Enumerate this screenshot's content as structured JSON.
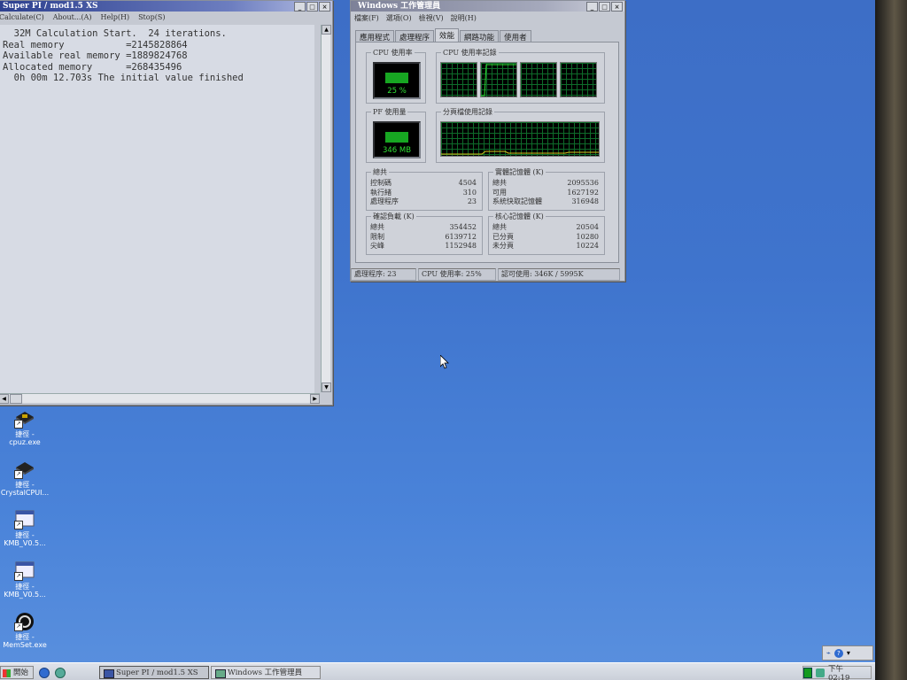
{
  "superpi": {
    "title": "Super PI / mod1.5 XS",
    "menu": [
      "Calculate(C)",
      "About...(A)",
      "Help(H)",
      "Stop(S)"
    ],
    "output_lines": [
      "  32M Calculation Start.  24 iterations.",
      "Real memory           =2145828864",
      "Available real memory =1889824768",
      "Allocated memory      =268435496",
      "  0h 00m 12.703s The initial value finished"
    ]
  },
  "taskmgr": {
    "title": "Windows 工作管理員",
    "menu": [
      "檔案(F)",
      "選項(O)",
      "檢視(V)",
      "說明(H)"
    ],
    "tabs": [
      "應用程式",
      "處理程序",
      "效能",
      "網路功能",
      "使用者"
    ],
    "active_tab": 2,
    "cpu_usage_label": "CPU 使用率",
    "cpu_usage_value": "25 %",
    "cpu_usage_fraction": 0.25,
    "cpu_history_label": "CPU 使用率記錄",
    "pf_usage_label": "PF 使用量",
    "pf_usage_value": "346 MB",
    "pf_history_label": "分頁檔使用記錄",
    "totals": {
      "label": "總共",
      "rows": [
        {
          "k": "控制碼",
          "v": "4504"
        },
        {
          "k": "執行緒",
          "v": "310"
        },
        {
          "k": "處理程序",
          "v": "23"
        }
      ]
    },
    "physical": {
      "label": "實體記憶體 (K)",
      "rows": [
        {
          "k": "總共",
          "v": "2095536"
        },
        {
          "k": "可用",
          "v": "1627192"
        },
        {
          "k": "系統快取記憶體",
          "v": "316948"
        }
      ]
    },
    "commit": {
      "label": "確認負載 (K)",
      "rows": [
        {
          "k": "總共",
          "v": "354452"
        },
        {
          "k": "限制",
          "v": "6139712"
        },
        {
          "k": "尖峰",
          "v": "1152948"
        }
      ]
    },
    "kernel": {
      "label": "核心記憶體 (K)",
      "rows": [
        {
          "k": "總共",
          "v": "20504"
        },
        {
          "k": "已分頁",
          "v": "10280"
        },
        {
          "k": "未分頁",
          "v": "10224"
        }
      ]
    },
    "status": {
      "processes": "處理程序: 23",
      "cpu": "CPU 使用率: 25%",
      "commit": "認可使用: 346K / 5995K"
    }
  },
  "desktop_icons": [
    {
      "line1": "捷徑 -",
      "line2": "cpuz.exe",
      "icon": "chip-icon"
    },
    {
      "line1": "捷徑 -",
      "line2": "CrystalCPUI...",
      "icon": "chip-icon"
    },
    {
      "line1": "捷徑 -",
      "line2": "KMB_V0.5...",
      "icon": "window-app-icon"
    },
    {
      "line1": "捷徑 -",
      "line2": "KMB_V0.5...",
      "icon": "window-app-icon"
    },
    {
      "line1": "捷徑 -",
      "line2": "MemSet.exe",
      "icon": "memset-ring-icon"
    }
  ],
  "taskbar": {
    "start_label": "開始",
    "tasks": [
      "Super PI / mod1.5 XS",
      "Windows 工作管理員"
    ],
    "clock": "下午 02:19"
  },
  "colors": {
    "desktop": "#3f74cd",
    "graph_bg": "#000000",
    "graph_line": "#2fe033",
    "pf_line": "#d9c21a"
  }
}
